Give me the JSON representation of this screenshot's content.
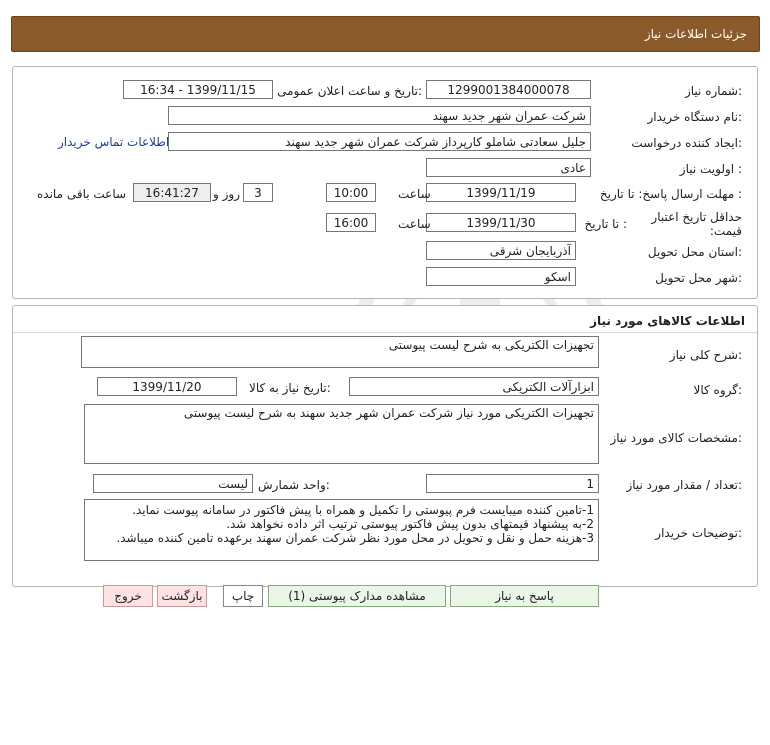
{
  "header": {
    "title": "جزئیات اطلاعات نیاز"
  },
  "details": {
    "need_number_label": "شماره نیاز:",
    "need_number": "1299001384000078",
    "announce_label": "تاریخ و ساعت اعلان عمومی:",
    "announce_value": "1399/11/15 - 16:34",
    "buyer_org_label": "نام دستگاه خریدار:",
    "buyer_org": "شرکت عمران شهر جدید سهند",
    "requester_label": "ایجاد کننده درخواست:",
    "requester": "جلیل سعادتی شاملو کارپرداز شرکت عمران شهر جدید سهند",
    "contact_link": "اطلاعات تماس خریدار",
    "priority_label": "اولویت نیاز :",
    "priority": "عادی",
    "deadline_label": "مهلت ارسال پاسخ: تا تاریخ :",
    "deadline_date": "1399/11/19",
    "time_label": "ساعت",
    "deadline_time": "10:00",
    "days_value": "3",
    "days_label": "روز و",
    "remaining_time": "16:41:27",
    "remaining_label": "ساعت باقی مانده",
    "validity_label": "حداقل تاریخ اعتبار قیمت:",
    "validity_to_label": "تا تاریخ :",
    "validity_date": "1399/11/30",
    "validity_time_label": "ساعت",
    "validity_time": "16:00",
    "province_label": "استان محل تحویل:",
    "province": "آذربایجان شرقی",
    "city_label": "شهر محل تحویل:",
    "city": "اسکو"
  },
  "goods": {
    "section_title": "اطلاعات کالاهای مورد نیاز",
    "general_desc_label": "شرح کلی نیاز:",
    "general_desc": "تجهیزات الکتریکی به شرح لیست پیوستی",
    "group_label": "گروه کالا:",
    "group": "ابزارآلات الکتریکی",
    "need_date_label": "تاریخ نیاز به کالا:",
    "need_date": "1399/11/20",
    "specs_label": "مشخصات کالای مورد نیاز:",
    "specs": "تجهیزات الکتریکی مورد نیاز شرکت عمران شهر جدید سهند به شرح لیست پیوستی",
    "qty_label": "تعداد / مقدار مورد نیاز:",
    "qty": "1",
    "unit_label": "واحد شمارش:",
    "unit": "لیست",
    "buyer_notes_label": "توضیحات خریدار:",
    "buyer_notes": [
      "1-تامین کننده میبایست فرم پیوستی را تکمیل و همراه با پیش فاکتور در سامانه پیوست نماید.",
      "2-به پیشنهاد قیمتهای بدون پیش فاکتور پیوستی ترتیب اثر داده نخواهد شد.",
      "3-هزینه حمل و نقل و تحویل در محل مورد نظر شرکت عمران سهند برعهده تامین کننده میباشد."
    ]
  },
  "buttons": {
    "reply": "پاسخ به نیاز",
    "attachments": "مشاهده مدارک پیوستی (1)",
    "print": "چاپ",
    "back": "بازگشت",
    "exit": "خروج"
  }
}
